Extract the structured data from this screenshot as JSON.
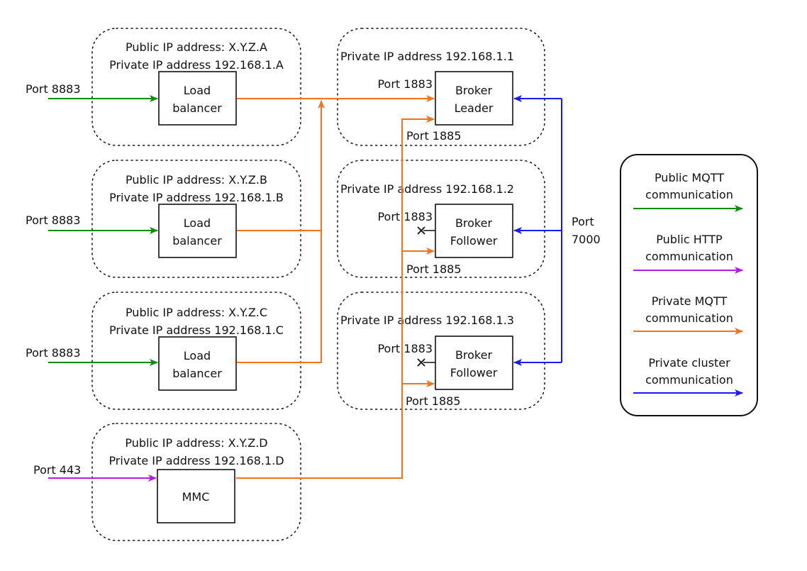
{
  "colors": {
    "public_mqtt": "#108a10",
    "public_http": "#b21ee6",
    "private_mqtt": "#f5721e",
    "private_cluster": "#1a1af2",
    "outline": "#111111"
  },
  "groups": [
    {
      "public": "Public IP address: X.Y.Z.A",
      "private": "Private IP address 192.168.1.A",
      "node": [
        "Load",
        "balancer"
      ],
      "port": "Port 8883",
      "in_kind": "public_mqtt"
    },
    {
      "public": "Public IP address: X.Y.Z.B",
      "private": "Private IP address 192.168.1.B",
      "node": [
        "Load",
        "balancer"
      ],
      "port": "Port 8883",
      "in_kind": "public_mqtt"
    },
    {
      "public": "Public IP address: X.Y.Z.C",
      "private": "Private IP address 192.168.1.C",
      "node": [
        "Load",
        "balancer"
      ],
      "port": "Port 8883",
      "in_kind": "public_mqtt"
    },
    {
      "public": "Public IP address: X.Y.Z.D",
      "private": "Private IP address 192.168.1.D",
      "node": [
        "MMC"
      ],
      "port": "Port 443",
      "in_kind": "public_http"
    }
  ],
  "brokers": [
    {
      "private": "Private IP address 192.168.1.1",
      "node": [
        "Broker",
        "Leader"
      ],
      "port_mqtt": "Port 1883",
      "port_internal": "Port 1885",
      "mqtt_open": true
    },
    {
      "private": "Private IP address 192.168.1.2",
      "node": [
        "Broker",
        "Follower"
      ],
      "port_mqtt": "Port 1883",
      "port_internal": "Port 1885",
      "mqtt_open": false
    },
    {
      "private": "Private IP address 192.168.1.3",
      "node": [
        "Broker",
        "Follower"
      ],
      "port_mqtt": "Port 1883",
      "port_internal": "Port 1885",
      "mqtt_open": false
    }
  ],
  "cluster_port": [
    "Port",
    "7000"
  ],
  "legend": [
    {
      "line1": "Public MQTT",
      "line2": "communication",
      "kind": "public_mqtt"
    },
    {
      "line1": "Public HTTP",
      "line2": "communication",
      "kind": "public_http"
    },
    {
      "line1": "Private MQTT",
      "line2": "communication",
      "kind": "private_mqtt"
    },
    {
      "line1": "Private cluster",
      "line2": "communication",
      "kind": "private_cluster"
    }
  ]
}
